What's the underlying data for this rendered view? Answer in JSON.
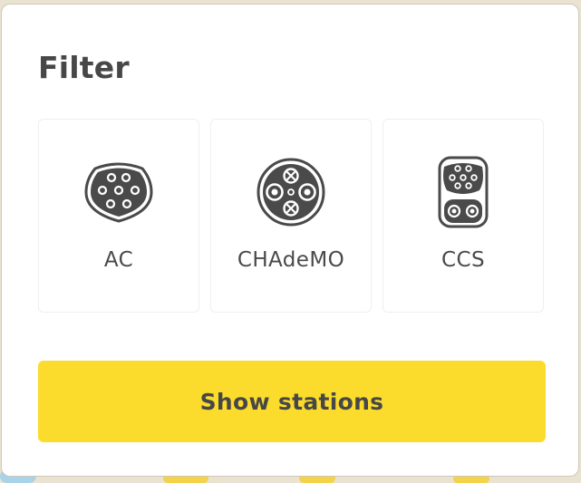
{
  "filter": {
    "title": "Filter",
    "connectors": [
      {
        "label": "AC",
        "icon": "type2-ac-plug-icon"
      },
      {
        "label": "CHAdeMO",
        "icon": "chademo-plug-icon"
      },
      {
        "label": "CCS",
        "icon": "ccs-plug-icon"
      }
    ],
    "show_button_label": "Show stations"
  },
  "colors": {
    "button_yellow": "#fbdc2c",
    "text_dark": "#474747",
    "icon_dark": "#4a4a4a"
  }
}
